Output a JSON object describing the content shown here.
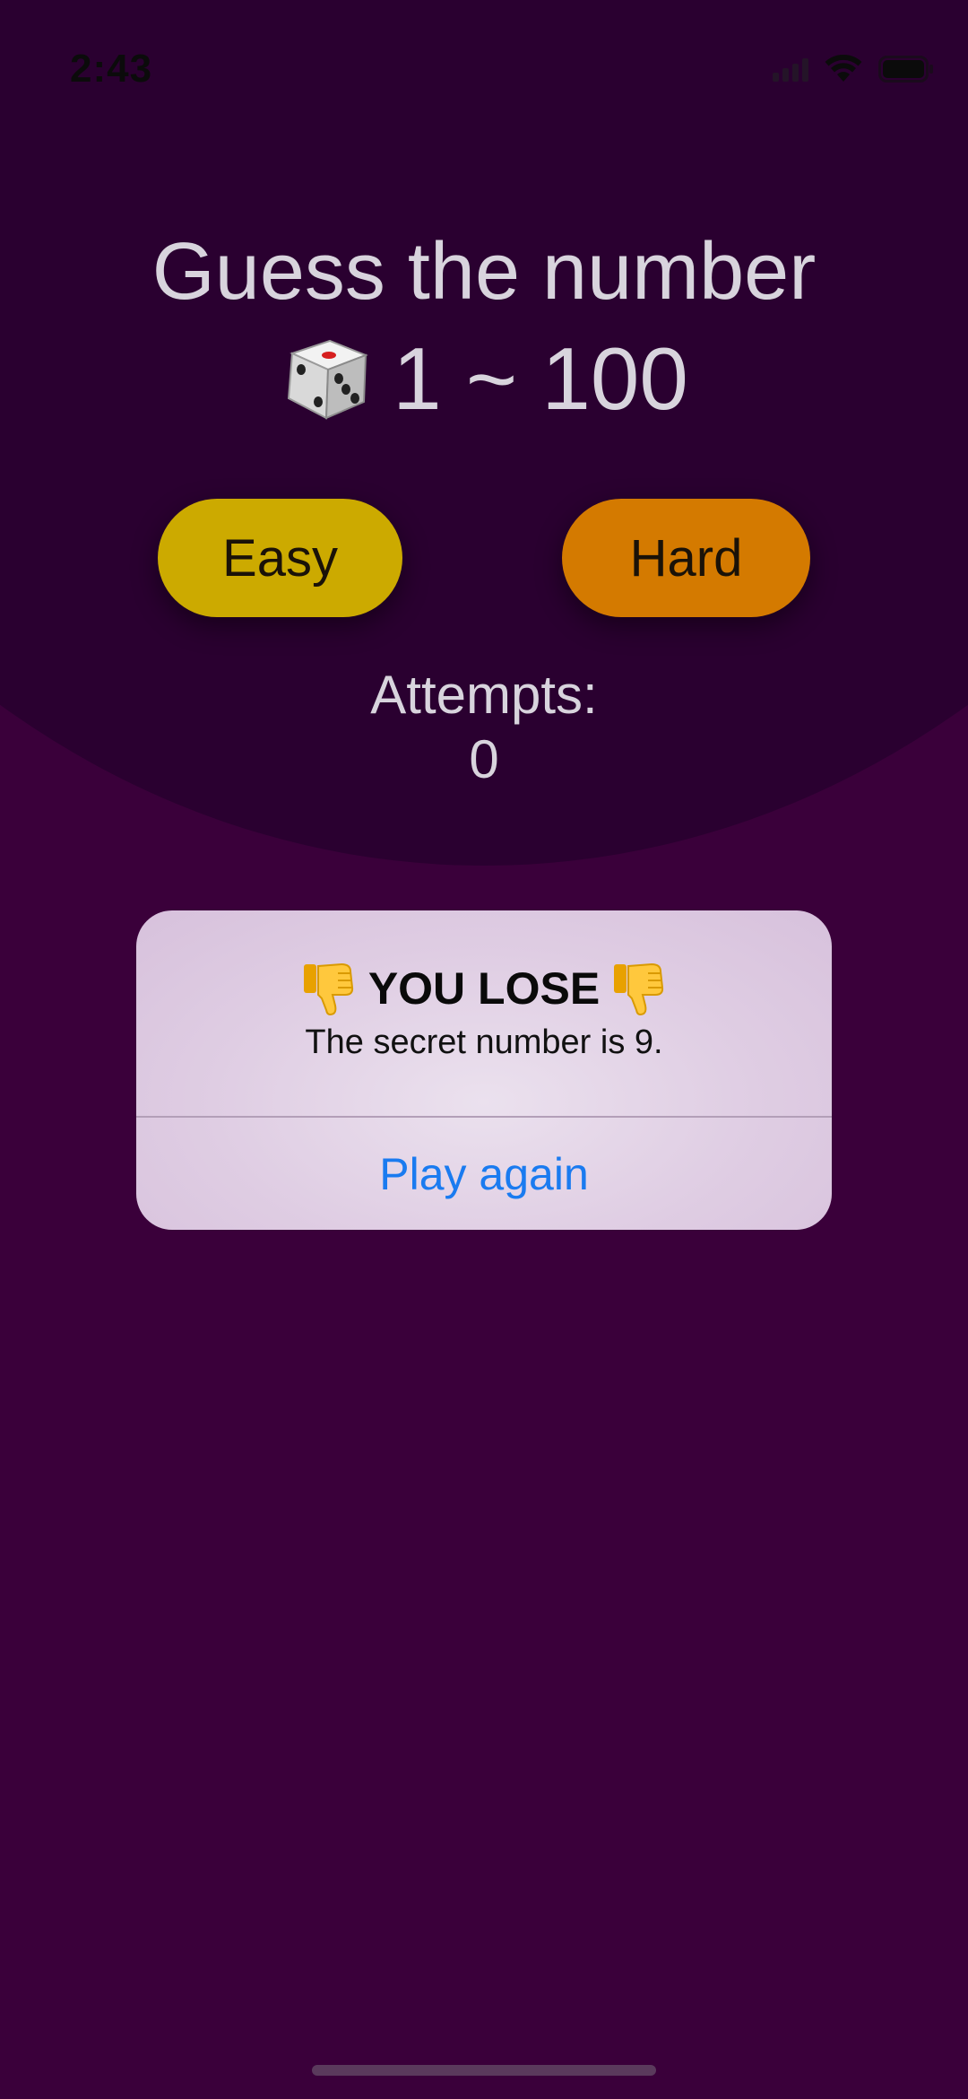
{
  "status_bar": {
    "time": "2:43",
    "icons": [
      "cell-signal-icon",
      "wifi-icon",
      "battery-icon"
    ]
  },
  "game": {
    "title": "Guess the number",
    "range_icon": "dice-icon",
    "range_text": "1 ~ 100",
    "buttons": {
      "easy_label": "Easy",
      "hard_label": "Hard"
    },
    "attempts_label": "Attempts:",
    "attempts_value": "0"
  },
  "alert": {
    "title_icon": "thumbs-down-icon",
    "title": "YOU LOSE",
    "message": "The secret number is 9.",
    "action_label": "Play again"
  },
  "colors": {
    "background": "#3a003a",
    "top_arc": "#2a0030",
    "easy_button": "#ccaa00",
    "hard_button": "#d47a00",
    "text_light": "#d8d4dd",
    "alert_action": "#1a7bf0"
  }
}
